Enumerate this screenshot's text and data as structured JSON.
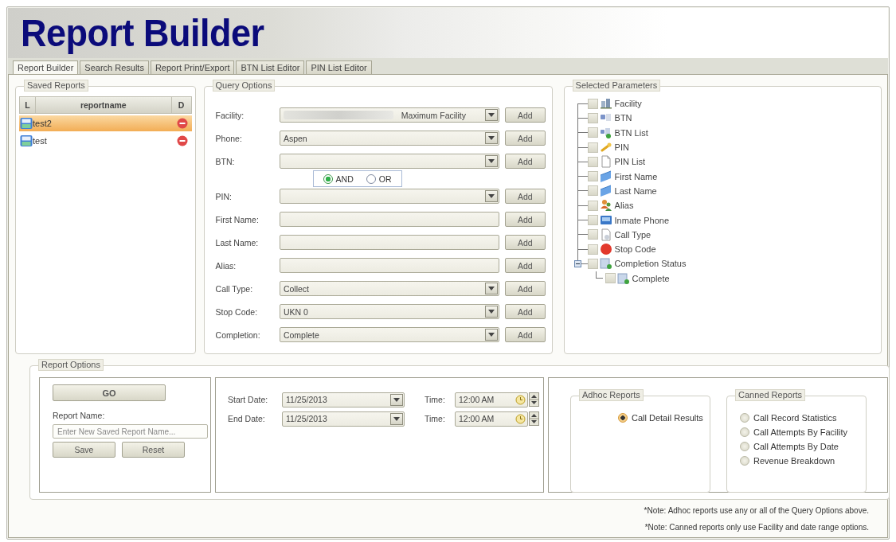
{
  "header": {
    "title": "Report Builder"
  },
  "tabs": [
    {
      "label": "Report Builder",
      "selected": true
    },
    {
      "label": "Search Results",
      "selected": false
    },
    {
      "label": "Report Print/Export",
      "selected": false
    },
    {
      "label": "BTN List Editor",
      "selected": false
    },
    {
      "label": "PIN List Editor",
      "selected": false
    }
  ],
  "saved_reports": {
    "title": "Saved Reports",
    "columns": [
      "L",
      "reportname",
      "D"
    ],
    "rows": [
      {
        "name": "test2",
        "selected": true
      },
      {
        "name": "test",
        "selected": false
      }
    ]
  },
  "query_options": {
    "title": "Query Options",
    "fields": [
      {
        "kind": "dropdown",
        "label": "Facility:",
        "value": "Maximum Facility",
        "button": "Add"
      },
      {
        "kind": "dropdown",
        "label": "Phone:",
        "value": "Aspen",
        "button": "Add"
      },
      {
        "kind": "dropdown",
        "label": "BTN:",
        "button": "Add"
      },
      {
        "kind": "logic",
        "options": [
          {
            "label": "AND",
            "selected": true
          },
          {
            "label": "OR",
            "selected": false
          }
        ]
      },
      {
        "kind": "dropdown",
        "label": "PIN:",
        "button": "Add"
      },
      {
        "kind": "text",
        "label": "First Name:",
        "button": "Add"
      },
      {
        "kind": "text",
        "label": "Last Name:",
        "button": "Add"
      },
      {
        "kind": "text",
        "label": "Alias:",
        "button": "Add"
      },
      {
        "kind": "dropdown",
        "label": "Call Type:",
        "value": "Collect",
        "button": "Add"
      },
      {
        "kind": "dropdown",
        "label": "Stop Code:",
        "value": "UKN 0",
        "button": "Add"
      },
      {
        "kind": "dropdown",
        "label": "Completion:",
        "value": "Complete",
        "button": "Add"
      }
    ]
  },
  "selected_parameters": {
    "title": "Selected Parameters",
    "tree": [
      {
        "label": "Facility",
        "checked": false
      },
      {
        "label": "BTN",
        "checked": false
      },
      {
        "label": "BTN List",
        "checked": false
      },
      {
        "label": "PIN",
        "checked": false
      },
      {
        "label": "PIN List",
        "checked": false
      },
      {
        "label": "First Name",
        "checked": false
      },
      {
        "label": "Last Name",
        "checked": false
      },
      {
        "label": "Alias",
        "checked": false
      },
      {
        "label": "Inmate Phone",
        "checked": false
      },
      {
        "label": "Call Type",
        "checked": false
      },
      {
        "label": "Stop Code",
        "checked": false
      },
      {
        "label": "Completion Status",
        "checked": false,
        "expanded": true,
        "children": [
          {
            "label": "Complete",
            "checked": false
          }
        ]
      }
    ]
  },
  "report_options": {
    "title": "Report Options",
    "go_button": "GO",
    "name_label": "Report Name:",
    "name_placeholder": "Enter New Saved Report Name...",
    "buttons": [
      "Save",
      "Reset"
    ],
    "dates": [
      {
        "label": "Start Date:",
        "value": "11/25/2013",
        "time_label": "Time:",
        "time": "12:00 AM"
      },
      {
        "label": "End Date:",
        "value": "11/25/2013",
        "time_label": "Time:",
        "time": "12:00 AM"
      }
    ],
    "adhoc": {
      "title": "Adhoc Reports",
      "options": [
        {
          "label": "Call Detail Results",
          "selected": true
        }
      ]
    },
    "canned": {
      "title": "Canned Reports",
      "options": [
        {
          "label": "Call Record Statistics",
          "selected": false
        },
        {
          "label": "Call Attempts By Facility",
          "selected": false
        },
        {
          "label": "Call Attempts By Date",
          "selected": false
        },
        {
          "label": "Revenue Breakdown",
          "selected": false
        }
      ]
    }
  },
  "notes": [
    "*Note: Adhoc reports use any or all of the Query Options above.",
    "*Note: Canned reports only use Facility and date range options."
  ]
}
